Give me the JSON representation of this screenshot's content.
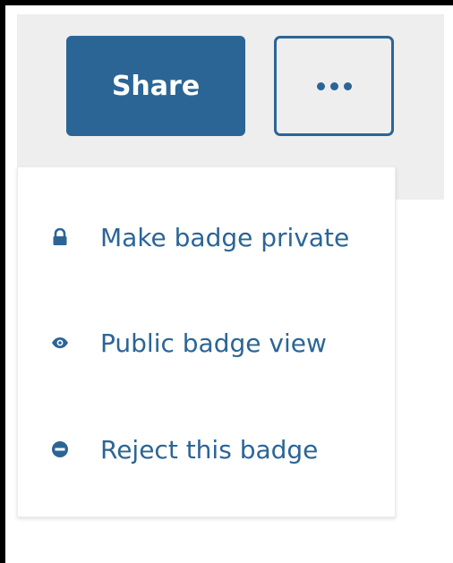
{
  "colors": {
    "accent": "#2b6596",
    "toolbar_bg": "#eeeeee",
    "frame": "#000000"
  },
  "toolbar": {
    "share_label": "Share",
    "more_icon": "ellipsis-icon"
  },
  "menu": {
    "items": [
      {
        "label": "Make badge private",
        "icon": "lock-icon"
      },
      {
        "label": "Public badge view",
        "icon": "eye-icon"
      },
      {
        "label": "Reject this badge",
        "icon": "minus-circle-icon"
      }
    ]
  }
}
